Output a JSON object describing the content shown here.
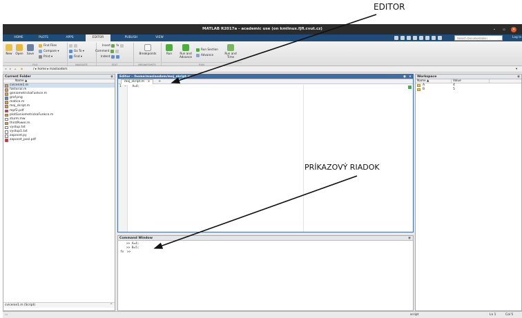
{
  "annotations": {
    "editor": "EDITOR",
    "command_line": "PRÍKAZOVÝ RIADOK"
  },
  "window": {
    "title": "MATLAB R2017a - academic use (on kmlinux.fjfi.cvut.cz)",
    "minimize": "–",
    "maximize": "▫",
    "close": "✕"
  },
  "tabs": [
    "HOME",
    "PLOTS",
    "APPS",
    "EDITOR",
    "PUBLISH",
    "VIEW"
  ],
  "active_tab": "EDITOR",
  "search": {
    "placeholder": "Search Documentation"
  },
  "login": "Log In",
  "ribbon": {
    "new": "New",
    "open": "Open",
    "save": "Save",
    "find_files": "Find Files",
    "compare": "Compare ▾",
    "print": "Print ▾",
    "go_to": "Go To ▾",
    "find": "Find ▾",
    "insert": "Insert",
    "comment": "Comment",
    "indent": "Indent",
    "fx": "fx",
    "breakpoints": "Breakpoints",
    "run": "Run",
    "run_and_advance": "Run and Advance",
    "run_section": "Run Section",
    "advance": "Advance",
    "run_and_time": "Run and Time",
    "sections": [
      "FILE",
      "NAVIGATE",
      "EDIT",
      "BREAKPOINTS",
      "RUN"
    ]
  },
  "address": {
    "path": "/ ▸ home ▸ maslaodom"
  },
  "current_folder": {
    "title": "Current Folder",
    "column": "Name ▲",
    "files": [
      {
        "name": "cvicenie1.m",
        "selected": true,
        "color": "#e0a32b"
      },
      {
        "name": "faktorial.m",
        "selected": false,
        "color": "#e0a32b"
      },
      {
        "name": "goniometrickaFunkce.m",
        "selected": false,
        "color": "#e0a32b"
      },
      {
        "name": "graf.png",
        "selected": false,
        "color": "#4a8fd1"
      },
      {
        "name": "matice.m",
        "selected": false,
        "color": "#e0a32b"
      },
      {
        "name": "moj_skript.m",
        "selected": false,
        "color": "#e0a32b"
      },
      {
        "name": "mpf2.pdf",
        "selected": false,
        "color": "#c33"
      },
      {
        "name": "plotGoniometrickaFunkce.m",
        "selected": false,
        "color": "#e0a32b"
      },
      {
        "name": "sturm.mw",
        "selected": false,
        "color": "#ffffff"
      },
      {
        "name": "thirdPower.m",
        "selected": false,
        "color": "#e0a32b"
      },
      {
        "name": "vystup.txt",
        "selected": false,
        "color": "#ffffff"
      },
      {
        "name": "vystup1.txt",
        "selected": false,
        "color": "#ffffff"
      },
      {
        "name": "zapocet.py",
        "selected": false,
        "color": "#ffffff"
      },
      {
        "name": "zapocet_posl.pdf",
        "selected": false,
        "color": "#c33"
      }
    ],
    "details": "cvicenie1.m  (Script)",
    "details_toggle": "^"
  },
  "editor": {
    "title": "Editor - /home/maslaodom/moj_skript.m",
    "tab_label": "moj_skript.m",
    "tab_close": "×",
    "new_tab": "+",
    "lines": [
      {
        "num": "1",
        "dash": "–",
        "code": "A=4;"
      }
    ]
  },
  "command_window": {
    "title": "Command Window",
    "lines": [
      ">> A=4;",
      ">> B=5;"
    ],
    "prompt_fx": "fx",
    "prompt": ">>"
  },
  "workspace": {
    "title": "Workspace",
    "col_name": "Name ▲",
    "col_value": "Value",
    "vars": [
      {
        "name": "A",
        "value": "4"
      },
      {
        "name": "B",
        "value": "5"
      }
    ]
  },
  "status": {
    "mode": "script",
    "ln": "Ln  1",
    "col": "Col  5"
  }
}
